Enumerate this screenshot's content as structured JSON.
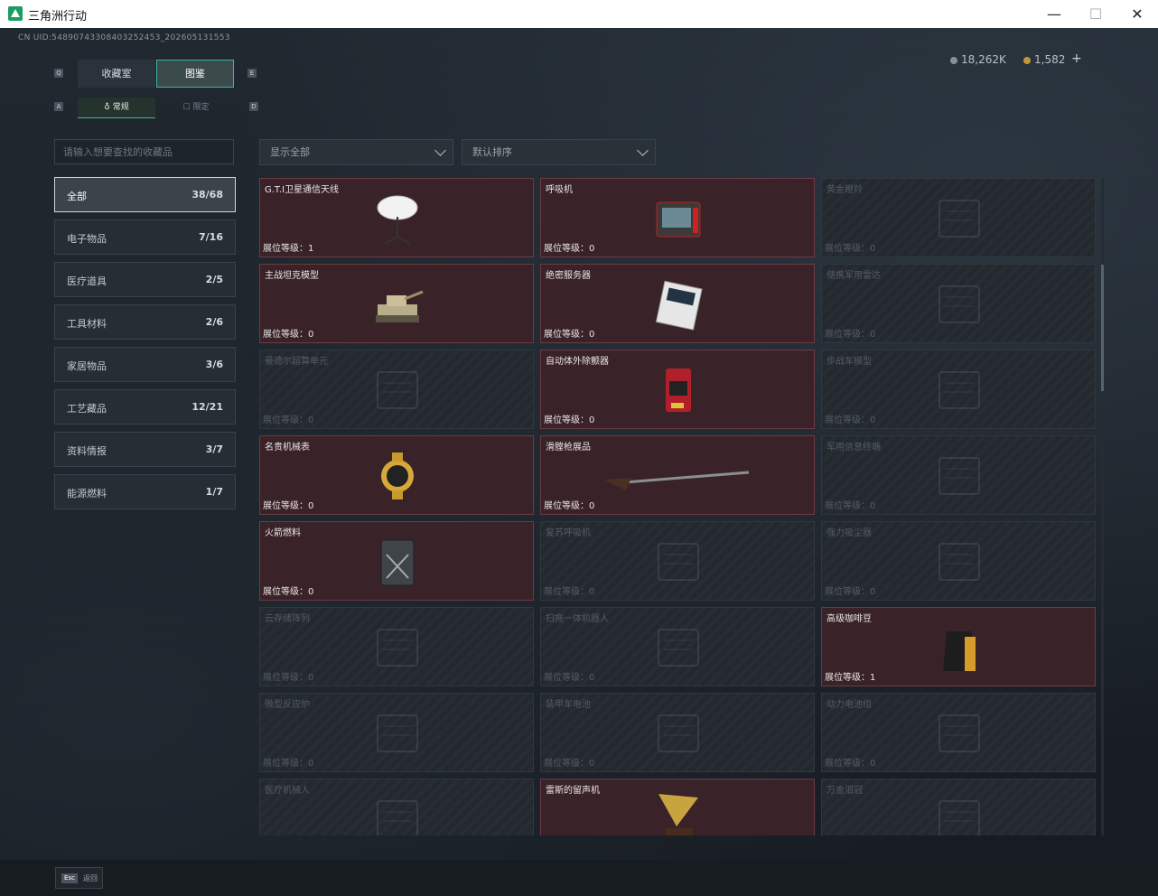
{
  "window": {
    "title": "三角洲行动",
    "minimize": "—",
    "maximize": "☐",
    "close": "✕"
  },
  "header": {
    "uid": "CN UID:5489074330840325245​3_202605131553",
    "currencies": [
      {
        "icon": "silver-coin-icon",
        "value": "18,262K"
      },
      {
        "icon": "gold-coin-icon",
        "value": "1,582"
      }
    ],
    "add_label": "+"
  },
  "tabs": {
    "items": [
      {
        "label": "收藏室"
      },
      {
        "label": "图鉴"
      }
    ],
    "active": 1,
    "hint_left": "Q",
    "hint_right": "E"
  },
  "subtabs": {
    "items": [
      {
        "label": "常规"
      },
      {
        "label": "限定"
      }
    ],
    "active": 0,
    "hint_left": "A",
    "hint_right": "D"
  },
  "search": {
    "placeholder": "请输入想要查找的收藏品"
  },
  "filters": {
    "display": "显示全部",
    "sort": "默认排序"
  },
  "categories": [
    {
      "label": "全部",
      "count": "38/68"
    },
    {
      "label": "电子物品",
      "count": "7/16"
    },
    {
      "label": "医疗道具",
      "count": "2/5"
    },
    {
      "label": "工具材料",
      "count": "2/6"
    },
    {
      "label": "家居物品",
      "count": "3/6"
    },
    {
      "label": "工艺藏品",
      "count": "12/21"
    },
    {
      "label": "资料情报",
      "count": "3/7"
    },
    {
      "label": "能源燃料",
      "count": "1/7"
    }
  ],
  "items": [
    {
      "name": "G.T.I卫星通信天线",
      "level": "展位等级：1",
      "owned": true,
      "icon": "satellite-dish-icon"
    },
    {
      "name": "呼吸机",
      "level": "展位等级：0",
      "owned": true,
      "icon": "ventilator-icon"
    },
    {
      "name": "黄金瞪羚",
      "level": "展位等级：0",
      "owned": false,
      "icon": "gazelle-icon"
    },
    {
      "name": "主战坦克模型",
      "level": "展位等级：0",
      "owned": true,
      "icon": "tank-model-icon"
    },
    {
      "name": "绝密服务器",
      "level": "展位等级：0",
      "owned": true,
      "icon": "server-icon"
    },
    {
      "name": "便携军用雷达",
      "level": "展位等级：0",
      "owned": false,
      "icon": "radar-icon"
    },
    {
      "name": "曼德尔超算单元",
      "level": "展位等级：0",
      "owned": false,
      "icon": "supercomputer-icon"
    },
    {
      "name": "自动体外除颤器",
      "level": "展位等级：0",
      "owned": true,
      "icon": "defibrillator-icon"
    },
    {
      "name": "步战车模型",
      "level": "展位等级：0",
      "owned": false,
      "icon": "ifv-model-icon"
    },
    {
      "name": "名贵机械表",
      "level": "展位等级：0",
      "owned": true,
      "icon": "watch-icon"
    },
    {
      "name": "滑膛枪展品",
      "level": "展位等级：0",
      "owned": true,
      "icon": "musket-icon"
    },
    {
      "name": "军用信息终端",
      "level": "展位等级：0",
      "owned": false,
      "icon": "terminal-icon"
    },
    {
      "name": "火箭燃料",
      "level": "展位等级：0",
      "owned": true,
      "icon": "fuel-can-icon"
    },
    {
      "name": "复苏呼吸机",
      "level": "展位等级：0",
      "owned": false,
      "icon": "resuscitator-icon"
    },
    {
      "name": "强力吸尘器",
      "level": "展位等级：0",
      "owned": false,
      "icon": "vacuum-icon"
    },
    {
      "name": "云存储阵列",
      "level": "展位等级：0",
      "owned": false,
      "icon": "storage-array-icon"
    },
    {
      "name": "扫拖一体机器人",
      "level": "展位等级：0",
      "owned": false,
      "icon": "robot-vacuum-icon"
    },
    {
      "name": "高级咖啡豆",
      "level": "展位等级：1",
      "owned": true,
      "icon": "coffee-bag-icon"
    },
    {
      "name": "微型反应炉",
      "level": "展位等级：0",
      "owned": false,
      "icon": "reactor-icon"
    },
    {
      "name": "装甲车电池",
      "level": "展位等级：0",
      "owned": false,
      "icon": "battery-icon"
    },
    {
      "name": "动力电池组",
      "level": "展位等级：0",
      "owned": false,
      "icon": "battery-pack-icon"
    },
    {
      "name": "医疗机械人",
      "level": "",
      "owned": false,
      "icon": "medical-robot-icon"
    },
    {
      "name": "雷斯的留声机",
      "level": "",
      "owned": true,
      "icon": "gramophone-icon"
    },
    {
      "name": "万金泪冠",
      "level": "",
      "owned": false,
      "icon": "crown-icon"
    }
  ],
  "footer": {
    "esc_key": "Esc",
    "back_label": "返回"
  }
}
